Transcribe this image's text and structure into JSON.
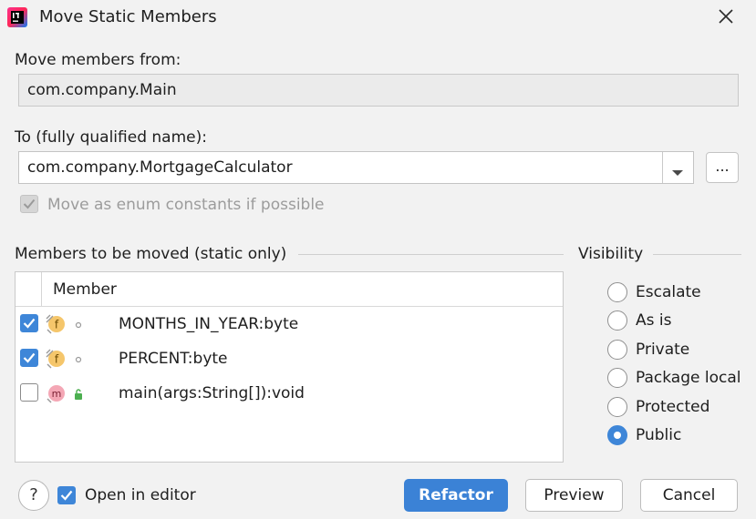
{
  "window": {
    "title": "Move Static Members",
    "app_icon": "intellij-idea-icon",
    "close_icon": "close-icon"
  },
  "from": {
    "label": "Move members from:",
    "value": "com.company.Main"
  },
  "to": {
    "label": "To (fully qualified name):",
    "value": "com.company.MortgageCalculator",
    "dropdown_icon": "chevron-down-icon",
    "browse_label": "..."
  },
  "enum_option": {
    "label": "Move as enum constants if possible",
    "checked": true,
    "enabled": false
  },
  "members": {
    "group_label": "Members to be moved (static only)",
    "column_header": "Member",
    "rows": [
      {
        "checked": true,
        "kind": "f",
        "visibility": "package-private",
        "label": "MONTHS_IN_YEAR:byte"
      },
      {
        "checked": true,
        "kind": "f",
        "visibility": "package-private",
        "label": "PERCENT:byte"
      },
      {
        "checked": false,
        "kind": "m",
        "visibility": "public",
        "label": "main(args:String[]):void"
      }
    ]
  },
  "visibility": {
    "group_label": "Visibility",
    "options": [
      "Escalate",
      "As is",
      "Private",
      "Package local",
      "Protected",
      "Public"
    ],
    "selected": "Public"
  },
  "footer": {
    "help_label": "?",
    "open_in_editor_label": "Open in editor",
    "open_in_editor_checked": true,
    "refactor_label": "Refactor",
    "preview_label": "Preview",
    "cancel_label": "Cancel"
  },
  "colors": {
    "accent": "#3b82d6",
    "field_icon_bg": "#f5c66b",
    "method_icon_bg": "#f4a7b5"
  }
}
